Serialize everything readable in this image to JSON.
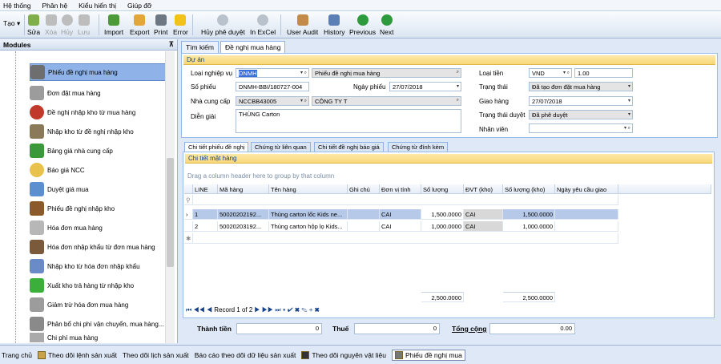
{
  "menu": [
    "Hệ thống",
    "Phân hệ",
    "Kiểu hiển thị",
    "Giúp đỡ"
  ],
  "toolbar": {
    "tao": "Tạo",
    "sua": "Sửa",
    "xoa": "Xóa",
    "huy": "Hủy",
    "luu": "Lưu",
    "import": "Import",
    "export": "Export",
    "print": "Print",
    "error": "Error",
    "huy_phe_duyet": "Hủy phê duyệt",
    "in_excel": "In ExCel",
    "user_audit": "User Audit",
    "history": "History",
    "previous": "Previous",
    "next": "Next"
  },
  "sidebar": {
    "title": "Modules",
    "items": [
      "Phiếu đề nghị mua hàng",
      "Đơn đặt mua hàng",
      "Đề nghị nhập kho từ mua hàng",
      "Nhập kho từ đề nghị nhập kho",
      "Bảng giá nhà cung cấp",
      "Báo giá NCC",
      "Duyệt giá mua",
      "Phiếu đề nghị nhập kho",
      "Hóa đơn mua hàng",
      "Hóa đơn nhập khẩu từ đơn mua hàng",
      "Nhập kho từ hóa đơn nhập khẩu",
      "Xuất kho trả hàng từ nhập kho",
      "Giảm trừ hóa đơn mua hàng",
      "Phân bổ chi phí vận chuyển, mua hàng...",
      "Chi phí mua hàng"
    ]
  },
  "tabs": [
    "Tìm kiếm",
    "Đề nghị mua hàng"
  ],
  "form": {
    "section": "Dự án",
    "loai_nghiep_vu_label": "Loại nghiệp vụ",
    "loai_nghiep_vu_code": "DNMH",
    "loai_nghiep_vu_name": "Phiếu đề nghị mua hàng",
    "so_phieu_label": "Số phiếu",
    "so_phieu": "DNMH-BBI/180727-004",
    "ngay_phieu_label": "Ngày phiếu",
    "ngay_phieu": "27/07/2018",
    "ncc_label": "Nhà cung cấp",
    "ncc_code": "NCCBB43005",
    "ncc_name": "CÔNG TY T",
    "dien_giai_label": "Diễn giải",
    "dien_giai": "THÙNG Carton",
    "loai_tien_label": "Loại tiền",
    "loai_tien": "VND",
    "ty_gia": "1.00",
    "trang_thai_label": "Trạng thái",
    "trang_thai": "Đã tạo đơn đặt mua hàng",
    "giao_hang_label": "Giao hàng",
    "giao_hang": "27/07/2018",
    "trang_thai_duyet_label": "Trạng thái duyệt",
    "trang_thai_duyet": "Đã phê duyệt",
    "nhan_vien_label": "Nhân viên",
    "nhan_vien": ""
  },
  "subtabs": [
    "Chi tiết phiếu đề nghị",
    "Chứng từ liên quan",
    "Chi tiết đề nghị báo giá",
    "Chứng từ đính kèm"
  ],
  "grid": {
    "section": "Chi tiết mặt hàng",
    "group_hint": "Drag a column header here to group by that column",
    "headers": [
      "LINE",
      "Mã hàng",
      "Tên hàng",
      "Ghi chú",
      "Đơn vị tính",
      "Số lượng",
      "ĐVT (kho)",
      "Số lượng (kho)",
      "Ngày yêu cầu giao"
    ],
    "rows": [
      [
        "1",
        "50020202192...",
        "Thùng carton lốc Kids ne...",
        "",
        "CAI",
        "1,500.0000",
        "CAI",
        "1,500.0000",
        ""
      ],
      [
        "2",
        "50020203192...",
        "Thùng carton hộp lọ Kids...",
        "",
        "CAI",
        "1,000.0000",
        "CAI",
        "1,000.0000",
        ""
      ]
    ],
    "sum_qty": "2,500.0000",
    "sum_qty_kho": "2,500.0000",
    "record": "Record 1 of 2"
  },
  "totals": {
    "thanh_tien_label": "Thành tiền",
    "thanh_tien": "0",
    "thue_label": "Thuế",
    "thue": "0",
    "tong_cong_label": "Tổng cộng",
    "tong_cong": "0.00"
  },
  "taskbar": [
    "Trang chủ",
    "Theo dõi lệnh sản xuất",
    "Theo dõi lịch sản xuất",
    "Báo cáo theo dõi dữ liệu sản xuất",
    "Theo dõi nguyên vật liệu",
    "Phiếu đề nghị mua"
  ]
}
